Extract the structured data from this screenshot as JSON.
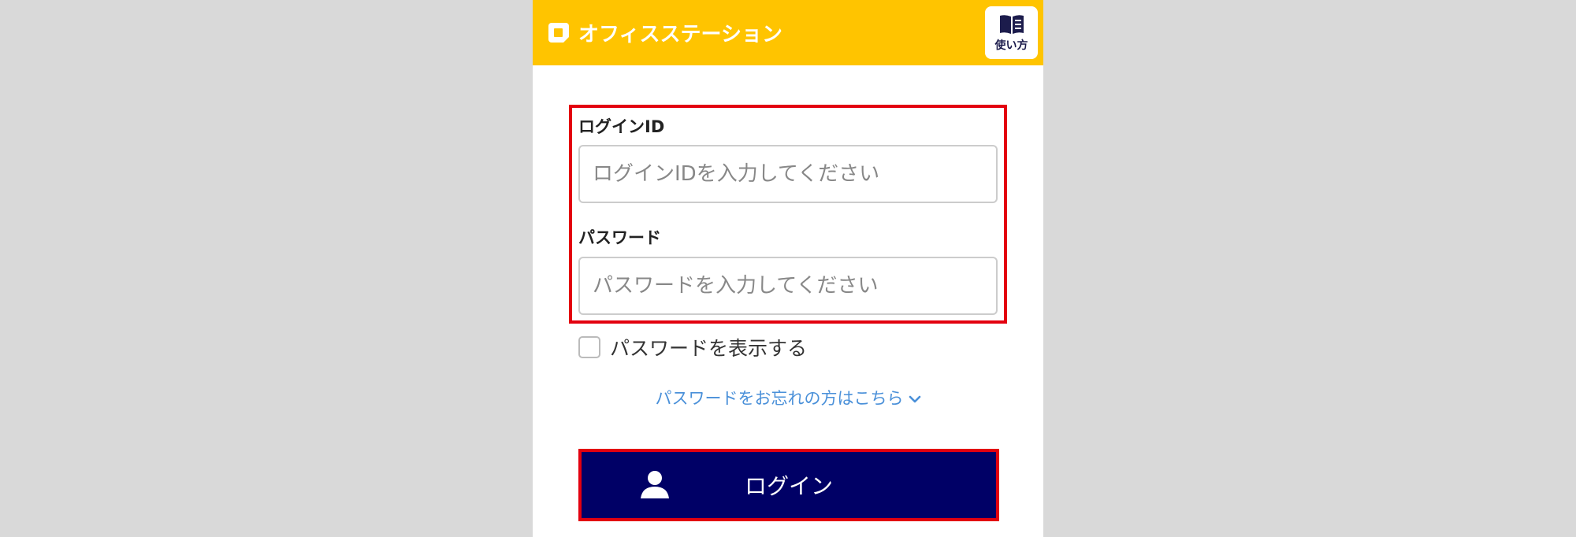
{
  "header": {
    "app_name": "オフィスステーション",
    "help_label": "使い方"
  },
  "form": {
    "login_id_label": "ログインID",
    "login_id_placeholder": "ログインIDを入力してください",
    "login_id_value": "",
    "password_label": "パスワード",
    "password_placeholder": "パスワードを入力してください",
    "password_value": "",
    "show_password_label": "パスワードを表示する",
    "show_password_checked": false,
    "forgot_password_link": "パスワードをお忘れの方はこちら",
    "login_button_label": "ログイン"
  },
  "colors": {
    "header_bg": "#ffc400",
    "login_button_bg": "#000066",
    "highlight_border": "#e3000f",
    "link": "#4a90d9"
  },
  "icons": {
    "logo": "office-station-logo-icon",
    "help": "book-icon",
    "forgot_chevron": "chevron-down-icon",
    "login": "user-icon"
  }
}
